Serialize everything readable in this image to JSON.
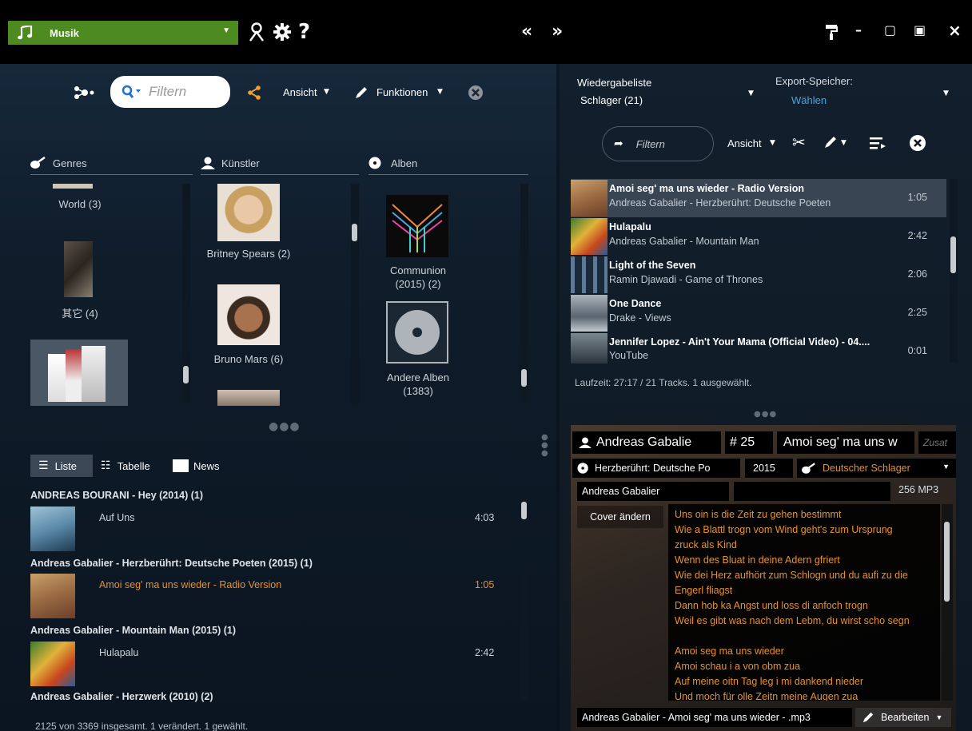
{
  "titlebar": {
    "library": "Musik",
    "nav_back": "«",
    "nav_forward": "»",
    "help": "?",
    "minimize": "–",
    "maximize": "▢",
    "miniplayer": "▣",
    "close": "×"
  },
  "toolbar": {
    "filter_placeholder": "Filtern",
    "view": "Ansicht",
    "functions": "Funktionen"
  },
  "columns": {
    "genres": {
      "header": "Genres",
      "items": [
        {
          "label": "World (3)"
        },
        {
          "label": "其它 (4)"
        }
      ]
    },
    "artists": {
      "header": "Künstler",
      "items": [
        {
          "label": "Britney Spears (2)"
        },
        {
          "label": "Bruno Mars (6)"
        }
      ]
    },
    "albums": {
      "header": "Alben",
      "items": [
        {
          "label": "Communion (2015) (2)"
        },
        {
          "label": "Andere Alben (1383)"
        }
      ]
    }
  },
  "views": {
    "list": "Liste",
    "table": "Tabelle",
    "news": "News"
  },
  "tracklist": [
    {
      "group": "ANDREAS BOURANI - Hey (2014) (1)",
      "title": "Auf Uns",
      "time": "4:03",
      "highlight": false
    },
    {
      "group": "Andreas Gabalier - Herzberührt: Deutsche Poeten (2015) (1)",
      "title": "Amoi seg' ma uns wieder - Radio Version",
      "time": "1:05",
      "highlight": true
    },
    {
      "group": "Andreas Gabalier - Mountain Man (2015) (1)",
      "title": "Hulapalu",
      "time": "2:42",
      "highlight": false
    },
    {
      "group": "Andreas Gabalier - Herzwerk (2010) (2)",
      "title": "",
      "time": "",
      "highlight": false
    }
  ],
  "left_status": "2125 von 3369 insgesamt. 1 verändert. 1 gewählt.",
  "playlist": {
    "label": "Wiedergabeliste",
    "name": "Schlager (21)",
    "export_label": "Export-Speicher:",
    "export_value": "Wählen",
    "filter_placeholder": "Filtern",
    "view": "Ansicht",
    "tracks": [
      {
        "title": "Amoi seg' ma uns wieder - Radio Version",
        "sub": "Andreas Gabalier - Herzberührt: Deutsche Poeten",
        "time": "1:05",
        "active": true
      },
      {
        "title": "Hulapalu",
        "sub": "Andreas Gabalier - Mountain Man",
        "time": "2:42",
        "active": false
      },
      {
        "title": "Light of the Seven",
        "sub": "Ramin Djawadi - Game of Thrones",
        "time": "2:06",
        "active": false
      },
      {
        "title": "One Dance",
        "sub": "Drake - Views",
        "time": "2:25",
        "active": false
      },
      {
        "title": "Jennifer Lopez - Ain't Your Mama (Official Video) - 04....",
        "sub": "YouTube",
        "time": "0:01",
        "active": false
      }
    ],
    "status": "Laufzeit: 27:17 / 21 Tracks.  1 ausgewählt."
  },
  "tag_editor": {
    "artist": "Andreas Gabalie",
    "track_no": "# 25",
    "title": "Amoi seg' ma uns w",
    "extra_placeholder": "Zusat",
    "album": "Herzberührt: Deutsche Po",
    "year": "2015",
    "genre": "Deutscher Schlager",
    "album_artist": "Andreas Gabalier",
    "format": "256 MP3",
    "cover_change": "Cover ändern",
    "lyrics": [
      "Uns oin is die Zeit zu gehen bestimmt",
      "Wie a Blattl trogn vom Wind geht's zum Ursprung",
      "zruck als Kind",
      "Wenn des Bluat in deine Adern gfriert",
      "Wie dei Herz aufhört zum Schlogn und du aufi zu die",
      "Engerl fliagst",
      "Dann hob ka Angst und loss di anfoch trogn",
      "Weil es gibt was nach dem Lebm, du wirst scho segn",
      "",
      "Amoi seg ma uns wieder",
      "Amoi schau i a von obm zua",
      "Auf meine oitn Tag leg i mi dankend nieder",
      "Und moch für olle Zeitn meine Augen zua"
    ],
    "filename": "Andreas Gabalier - Amoi seg' ma uns wieder - .mp3",
    "edit": "Bearbeiten"
  },
  "colors": {
    "accent": "#e8912b",
    "library_green": "#4d8a1f"
  }
}
